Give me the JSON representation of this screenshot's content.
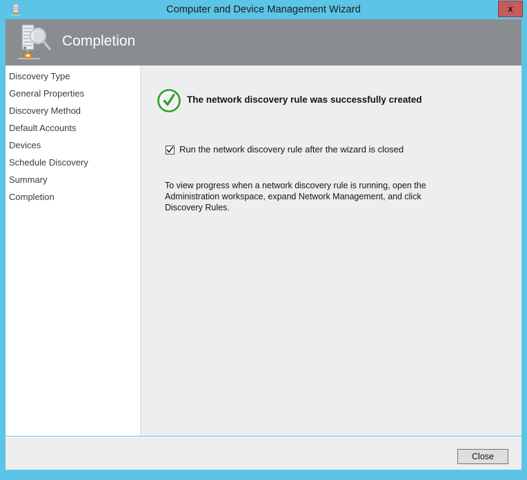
{
  "window": {
    "title": "Computer and Device Management Wizard",
    "close_x_label": "x",
    "titlebar_icon": "server-icon",
    "accent_color": "#5bc4e7",
    "close_button_color": "#c75b5b"
  },
  "header": {
    "step_title": "Completion",
    "icon": "server-discovery-icon",
    "band_color": "#898d90"
  },
  "sidebar": {
    "items": [
      {
        "label": "Discovery Type"
      },
      {
        "label": "General Properties"
      },
      {
        "label": "Discovery Method"
      },
      {
        "label": "Default Accounts"
      },
      {
        "label": "Devices"
      },
      {
        "label": "Schedule Discovery"
      },
      {
        "label": "Summary"
      },
      {
        "label": "Completion"
      }
    ]
  },
  "content": {
    "status_icon": "success-check-icon",
    "status_color": "#2aa02a",
    "status_message": "The network discovery rule was successfully created",
    "checkbox": {
      "label": "Run the network discovery rule after the wizard is closed",
      "checked": true
    },
    "note": "To view progress when a network discovery rule is running, open the Administration workspace, expand Network Management, and click Discovery Rules."
  },
  "footer": {
    "close_label": "Close"
  }
}
